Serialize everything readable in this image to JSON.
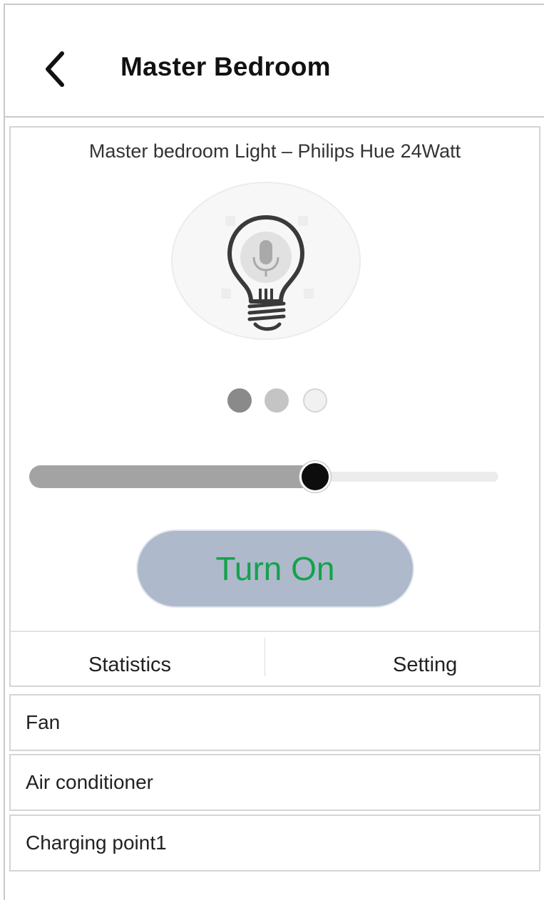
{
  "header": {
    "title": "Master Bedroom",
    "back_icon": "chevron-left-icon"
  },
  "device": {
    "title": "Master bedroom Light – Philips Hue 24Watt",
    "icon": "lightbulb-icon",
    "overlay_icon": "microphone-icon",
    "brightness_percent": 61,
    "color_options": [
      "#8a8a8a",
      "#c4c4c4",
      "#f1f1f1"
    ],
    "turn_on_label": "Turn On",
    "turn_on_text_color": "#14a24a",
    "turn_on_bg_color": "#aeb9cc"
  },
  "tabs": [
    {
      "label": "Statistics"
    },
    {
      "label": "Setting"
    }
  ],
  "devices_list": [
    {
      "label": "Fan"
    },
    {
      "label": "Air conditioner"
    },
    {
      "label": "Charging point1"
    }
  ]
}
